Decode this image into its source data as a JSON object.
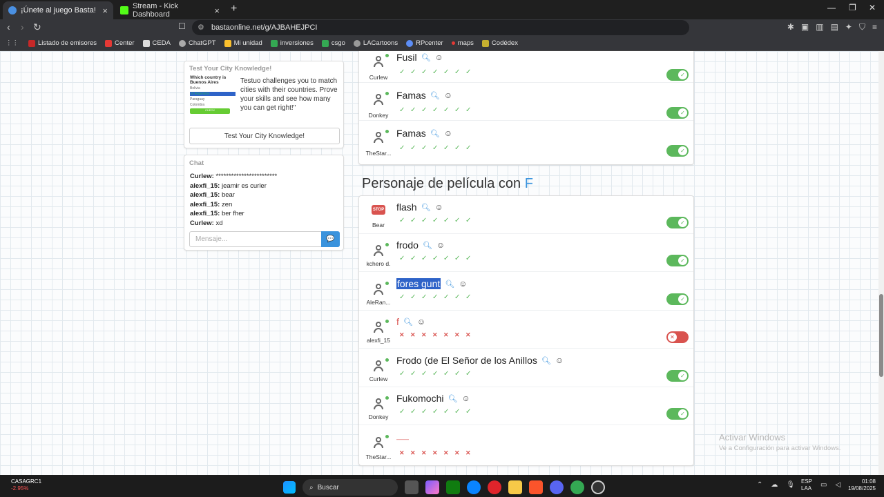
{
  "browser": {
    "tabs": [
      {
        "title": "¡Únete al juego Basta!",
        "active": true
      },
      {
        "title": "Stream - Kick Dashboard",
        "active": false
      }
    ],
    "url": "bastaonline.net/g/AJBAHEJPCI",
    "bookmarks": [
      "Listado de emisores",
      "Center",
      "CEDA",
      "ChatGPT",
      "Mi unidad",
      "inversiones",
      "csgo",
      "LACartoons",
      "RPcenter",
      "maps",
      "Codédex"
    ]
  },
  "ad": {
    "title": "Test Your City Knowledge!",
    "quiz_question": "Which country is Buenos Aires",
    "quiz_options": [
      "Bolivia",
      "Argentina",
      "Paraguay",
      "Colombia"
    ],
    "quiz_button": "CHECK",
    "text": "Testuo challenges you to match cities with their countries. Prove your skills and see how many you can get right!\"",
    "button": "Test Your City Knowledge!"
  },
  "chat": {
    "title": "Chat",
    "messages": [
      {
        "user": "Curlew:",
        "text": " ************************"
      },
      {
        "user": "alexfi_15:",
        "text": " jeamir es curler"
      },
      {
        "user": "alexfi_15:",
        "text": " bear"
      },
      {
        "user": "alexfi_15:",
        "text": " zen"
      },
      {
        "user": "alexfi_15:",
        "text": " ber fher"
      },
      {
        "user": "Curlew:",
        "text": " xd"
      }
    ],
    "input_placeholder": "Mensaje..."
  },
  "upper_answers": [
    {
      "user": "Curlew",
      "word": "Fusil",
      "valid": true
    },
    {
      "user": "Donkey",
      "word": "Famas",
      "valid": true
    },
    {
      "user": "TheStar...",
      "word": "Famas",
      "valid": true
    }
  ],
  "section": {
    "title": "Personaje de película con",
    "letter": "F"
  },
  "answers": [
    {
      "user": "Bear",
      "word": "flash",
      "valid": true,
      "stop": true
    },
    {
      "user": "kchero d.",
      "word": "frodo",
      "valid": true
    },
    {
      "user": "AleRan...",
      "word": "fores gunt",
      "valid": true,
      "selected": true
    },
    {
      "user": "alexfi_15",
      "word": "f",
      "valid": false
    },
    {
      "user": "Curlew",
      "word": "Frodo (de El Señor de los Anillos",
      "valid": true
    },
    {
      "user": "Donkey",
      "word": "Fukomochi",
      "valid": true
    },
    {
      "user": "TheStar...",
      "word": "——",
      "valid": false,
      "red": true
    }
  ],
  "watermark": {
    "line1": "Activar Windows",
    "line2": "Ve a Configuración para activar Windows."
  },
  "taskbar": {
    "stock_name": "CASAGRC1",
    "stock_change": "-2.95%",
    "search": "Buscar",
    "lang1": "ESP",
    "lang2": "LAA",
    "time": "01:08",
    "date": "19/08/2025"
  },
  "colors": {
    "accent": "#3a93dd",
    "valid": "#5cb85c",
    "invalid": "#d9534f"
  }
}
